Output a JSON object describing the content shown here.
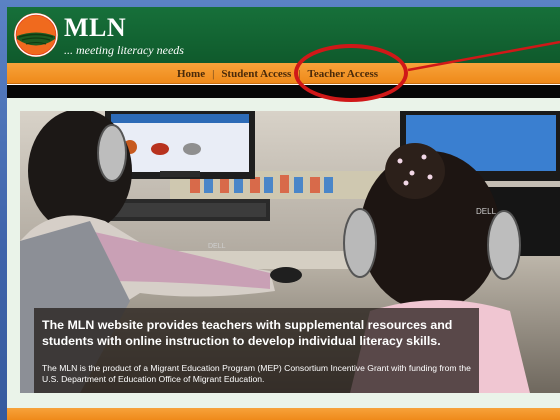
{
  "brand": {
    "title": "MLN",
    "tagline": "... meeting literacy needs"
  },
  "nav": {
    "items": [
      {
        "label": "Home"
      },
      {
        "label": "Student Access"
      },
      {
        "label": "Teacher Access"
      }
    ],
    "separator": "|"
  },
  "hero": {
    "headline": "The MLN website provides teachers with supplemental resources and students with online instruction to develop individual literacy skills.",
    "body": "The MLN is the product of a Migrant Education Program (MEP) Consortium Incentive Grant with funding from the U.S. Department of Education Office of Migrant Education.",
    "monitor_brand": "DELL"
  },
  "colors": {
    "header_green": "#17703a",
    "nav_orange": "#ef8a1a",
    "callout_red": "#d01818",
    "page_background_blue": "#4a70b6"
  },
  "annotations": {
    "callout": "red-ellipse-highlighting-teacher-access"
  }
}
